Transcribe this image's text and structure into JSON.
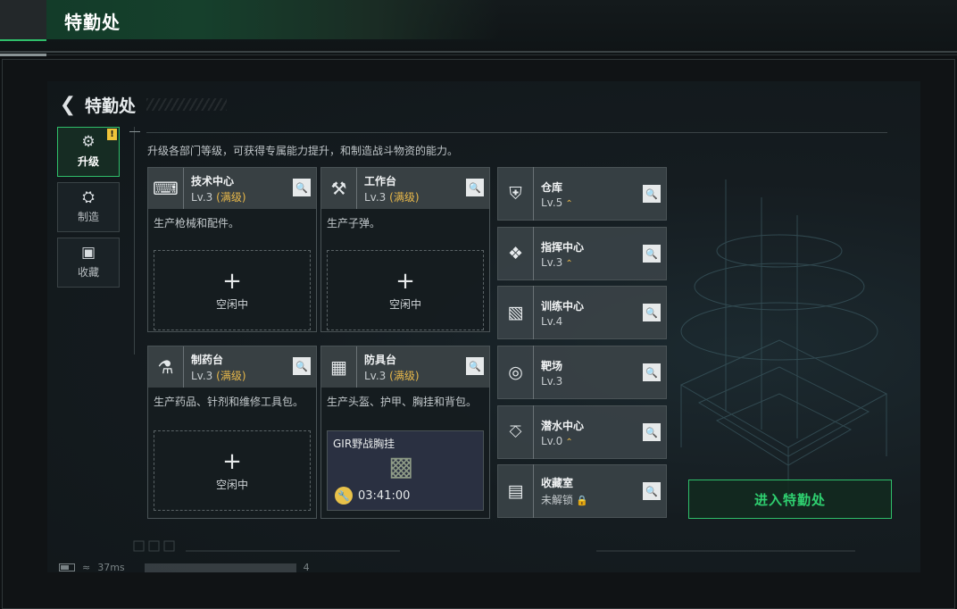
{
  "topbar": {
    "title": "特勤处"
  },
  "header": {
    "title": "特勤处"
  },
  "sidenav": [
    {
      "label": "升级",
      "icon": "upgrade-icon",
      "active": true,
      "badge": "!"
    },
    {
      "label": "制造",
      "icon": "gears-icon",
      "active": false
    },
    {
      "label": "收藏",
      "icon": "collection-icon",
      "active": false
    }
  ],
  "hint": "升级各部门等级，可获得专属能力提升，和制造战斗物资的能力。",
  "workshops": [
    {
      "name": "技术中心",
      "level": "Lv.3",
      "maxed": "(满级)",
      "desc": "生产枪械和配件。",
      "slot": {
        "plus": "+",
        "status": "空闲中"
      }
    },
    {
      "name": "工作台",
      "level": "Lv.3",
      "maxed": "(满级)",
      "desc": "生产子弹。",
      "slot": {
        "plus": "+",
        "status": "空闲中"
      }
    },
    {
      "name": "制药台",
      "level": "Lv.3",
      "maxed": "(满级)",
      "desc": "生产药品、针剂和维修工具包。",
      "slot": {
        "plus": "+",
        "status": "空闲中"
      }
    },
    {
      "name": "防具台",
      "level": "Lv.3",
      "maxed": "(满级)",
      "desc": "生产头盔、护甲、胸挂和背包。",
      "craft": {
        "item": "GIR野战胸挂",
        "timer": "03:41:00"
      }
    }
  ],
  "facilities": [
    {
      "name": "仓库",
      "level": "Lv.5",
      "upgradable": true
    },
    {
      "name": "指挥中心",
      "level": "Lv.3",
      "upgradable": true
    },
    {
      "name": "训练中心",
      "level": "Lv.4",
      "upgradable": false
    },
    {
      "name": "靶场",
      "level": "Lv.3",
      "upgradable": false
    },
    {
      "name": "潜水中心",
      "level": "Lv.0",
      "upgradable": true
    },
    {
      "name": "收藏室",
      "level": "未解锁",
      "locked": true
    }
  ],
  "enter_button": "进入特勤处",
  "status": {
    "ping": "37ms",
    "suffix": "4"
  },
  "colors": {
    "accent": "#2fbf6a",
    "maxed": "#e8b84a",
    "badge": "#f0c43a"
  }
}
